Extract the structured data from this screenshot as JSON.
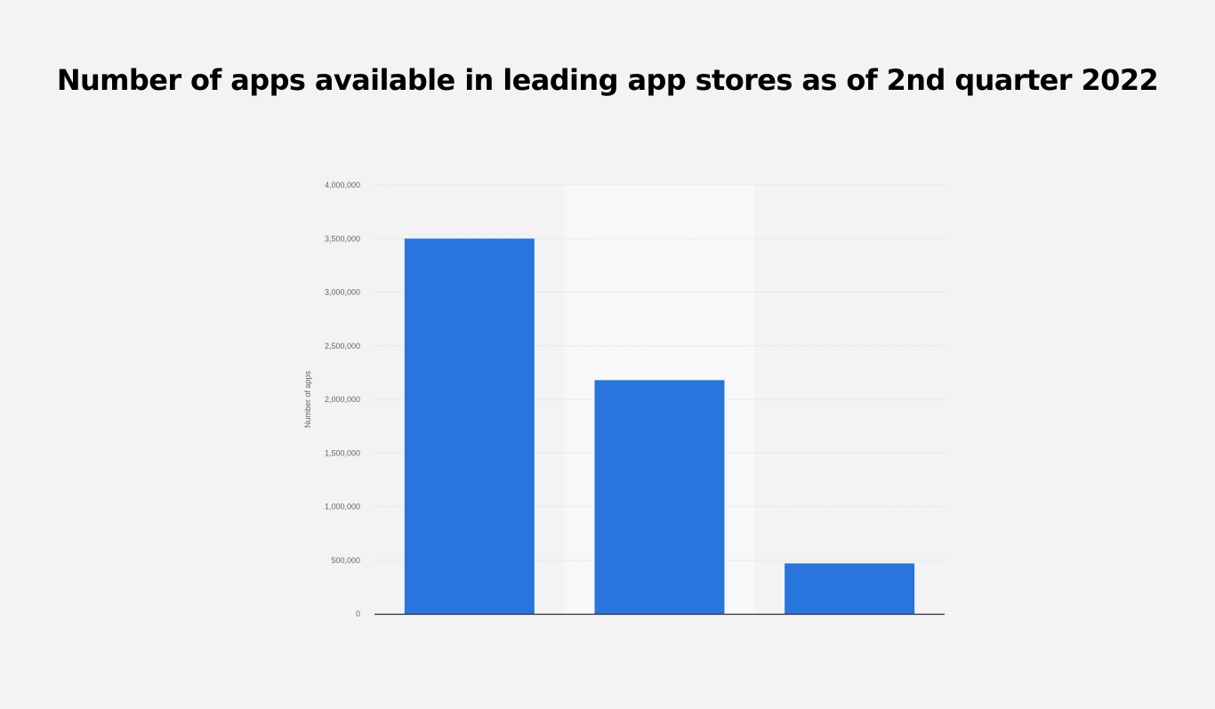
{
  "page": {
    "title": "Number of apps available in leading app stores as of 2nd quarter 2022"
  },
  "colors": {
    "bar": "#2775dd",
    "grid": "#dcdcdc",
    "axis": "#333333",
    "highlight": "#f8f8f8"
  },
  "chart_data": {
    "type": "bar",
    "title": "Number of apps available in leading app stores as of 2nd quarter 2022",
    "ylabel": "Number of apps",
    "xlabel": "",
    "categories": [
      "",
      "",
      ""
    ],
    "values": [
      3500000,
      2180000,
      470000
    ],
    "ylim": [
      0,
      4000000
    ],
    "yticks": [
      0,
      500000,
      1000000,
      1500000,
      2000000,
      2500000,
      3000000,
      3500000,
      4000000
    ],
    "ytick_labels": [
      "0",
      "500,000",
      "1,000,000",
      "1,500,000",
      "2,000,000",
      "2,500,000",
      "3,000,000",
      "3,500,000",
      "4,000,000"
    ],
    "grid": true,
    "highlighted_category_index": 1
  }
}
